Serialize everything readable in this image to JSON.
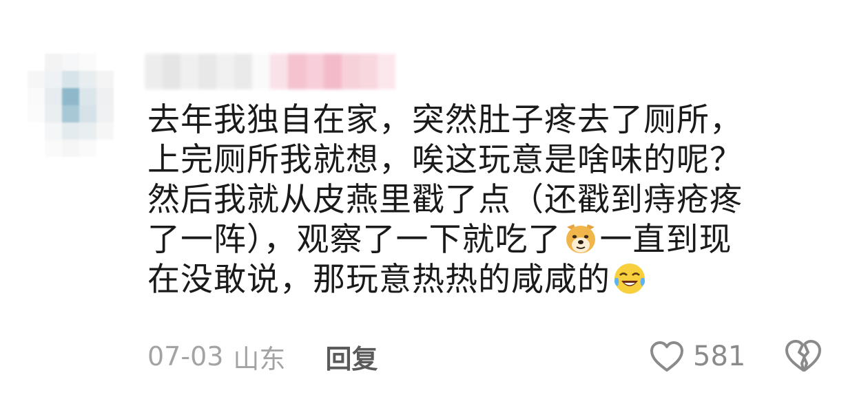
{
  "comment": {
    "lines": [
      "去年我独自在家，突然肚子疼去了厕所，",
      "上完厕所我就想，唉这玩意是啥味的呢？",
      "然后我就从皮燕里戳了点（还戳到痔疮疼",
      "了一阵），观察了一下就吃了",
      "一直到现",
      "在没敢说，那玩意热热的咸咸的"
    ],
    "emoji": [
      "doge-emoji",
      "crying-laughing-emoji"
    ]
  },
  "meta": {
    "date": "07-03",
    "location": "山东",
    "reply_label": "回复"
  },
  "actions": {
    "like_count": "581",
    "like_icon": "heart-outline-icon",
    "dislike_icon": "broken-heart-outline-icon"
  },
  "colors": {
    "text": "#1a1a1a",
    "meta": "#a3a3a3",
    "reply": "#5a5a5a",
    "icon": "#8a8a8a"
  }
}
